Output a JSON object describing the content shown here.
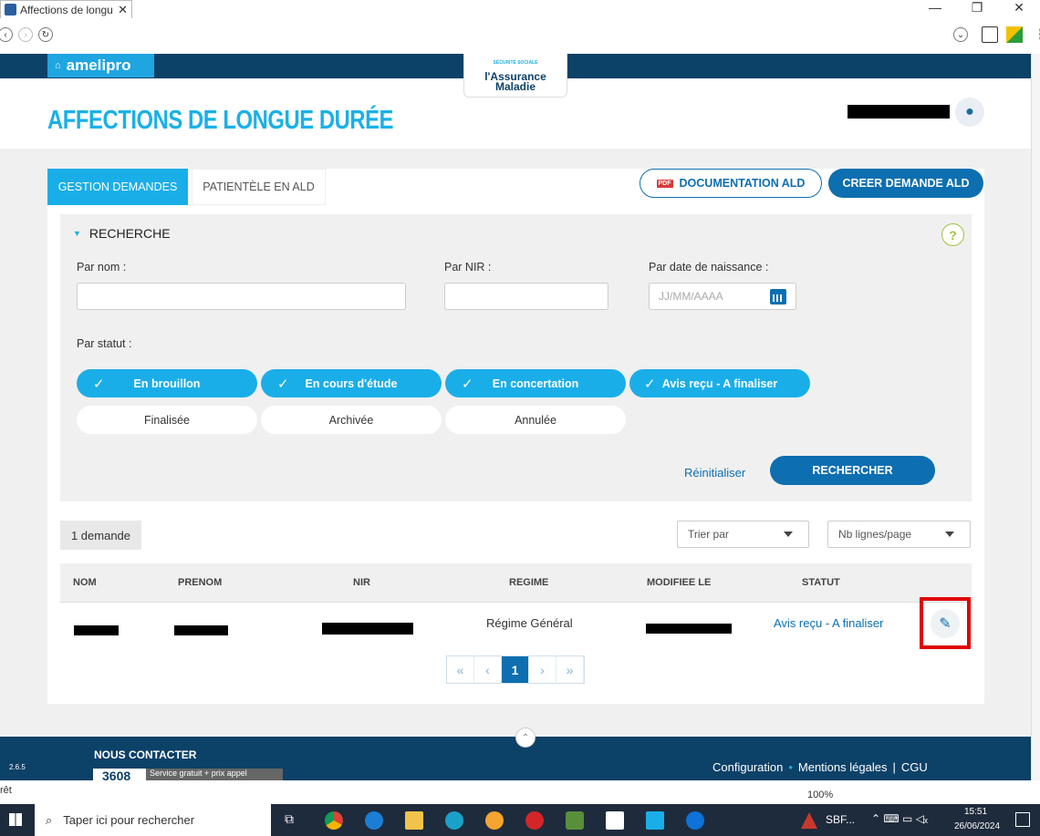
{
  "browser": {
    "tab_title": "Affections de longu",
    "tab_close": "✕",
    "minimize": "—",
    "restore": "❐",
    "close": "✕"
  },
  "site": {
    "brand": "amelipro",
    "logo_small": "SÉCURITÉ SOCIALE",
    "logo_line1": "l'Assurance",
    "logo_line2": "Maladie",
    "page_title": "AFFECTIONS DE LONGUE DURÉE"
  },
  "tabs": {
    "gestion": "GESTION DEMANDES",
    "patientele": "PATIENTÈLE EN ALD"
  },
  "actions": {
    "doc_pdf": "PDF",
    "doc": "DOCUMENTATION ALD",
    "creer": "CREER DEMANDE ALD"
  },
  "search": {
    "title": "RECHERCHE",
    "help": "?",
    "nom_label": "Par nom :",
    "nir_label": "Par NIR :",
    "dob_label": "Par date de naissance :",
    "dob_placeholder": "JJ/MM/AAAA",
    "statut_label": "Par statut :",
    "statuses": [
      {
        "label": "En brouillon",
        "selected": true
      },
      {
        "label": "En cours d'étude",
        "selected": true
      },
      {
        "label": "En concertation",
        "selected": true
      },
      {
        "label": "Avis reçu - A finaliser",
        "selected": true
      },
      {
        "label": "Finalisée",
        "selected": false
      },
      {
        "label": "Archivée",
        "selected": false
      },
      {
        "label": "Annulée",
        "selected": false
      }
    ],
    "reset": "Réinitialiser",
    "submit": "RECHERCHER"
  },
  "results": {
    "count": "1 demande",
    "sort_placeholder": "Trier par",
    "rows_placeholder": "Nb lignes/page",
    "columns": [
      "NOM",
      "PRENOM",
      "NIR",
      "REGIME",
      "MODIFIEE LE",
      "STATUT"
    ],
    "row": {
      "regime": "Régime Général",
      "statut": "Avis reçu - A finaliser"
    },
    "pager": {
      "first": "«",
      "prev": "‹",
      "current": "1",
      "next": "›",
      "last": "»"
    }
  },
  "footer": {
    "version": "2.6.5",
    "contact": "NOUS CONTACTER",
    "phone": "3608",
    "phone_note": "Service gratuit + prix appel",
    "config": "Configuration",
    "legal": "Mentions légales",
    "sep": "|",
    "cgu": "CGU",
    "bullet": "•"
  },
  "status_bar": {
    "left": "rêt",
    "zoom": "100%"
  },
  "taskbar": {
    "search_placeholder": "Taper ici pour rechercher",
    "app_label": "SBF...",
    "time": "15:51",
    "date": "26/06/2024"
  }
}
